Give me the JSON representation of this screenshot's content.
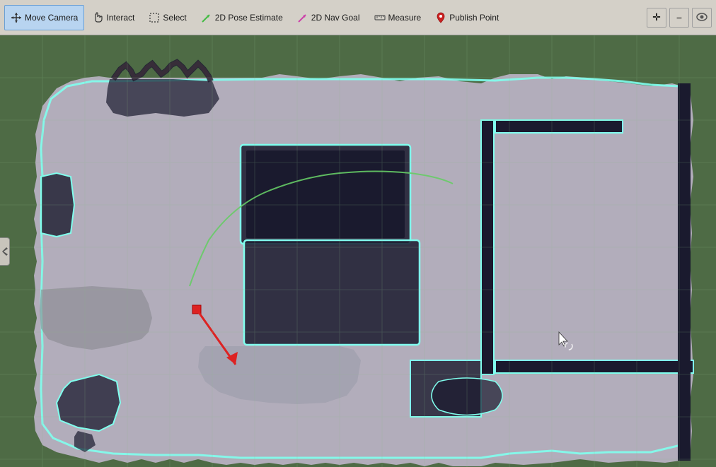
{
  "toolbar": {
    "tools": [
      {
        "id": "move-camera",
        "label": "Move Camera",
        "icon": "move",
        "active": true
      },
      {
        "id": "interact",
        "label": "Interact",
        "icon": "hand",
        "active": false
      },
      {
        "id": "select",
        "label": "Select",
        "icon": "select",
        "active": false
      },
      {
        "id": "pose-estimate",
        "label": "2D Pose Estimate",
        "icon": "arrow-green",
        "active": false
      },
      {
        "id": "nav-goal",
        "label": "2D Nav Goal",
        "icon": "arrow-pink",
        "active": false
      },
      {
        "id": "measure",
        "label": "Measure",
        "icon": "measure",
        "active": false
      },
      {
        "id": "publish-point",
        "label": "Publish Point",
        "icon": "pin",
        "active": false
      }
    ],
    "right_buttons": [
      {
        "id": "add",
        "icon": "+",
        "label": "Add"
      },
      {
        "id": "minus",
        "icon": "−",
        "label": "Minus"
      },
      {
        "id": "eye",
        "icon": "👁",
        "label": "Eye"
      }
    ]
  },
  "map": {
    "background_color": "#4e6b45",
    "grid_color": "rgba(100,140,100,0.3)"
  }
}
